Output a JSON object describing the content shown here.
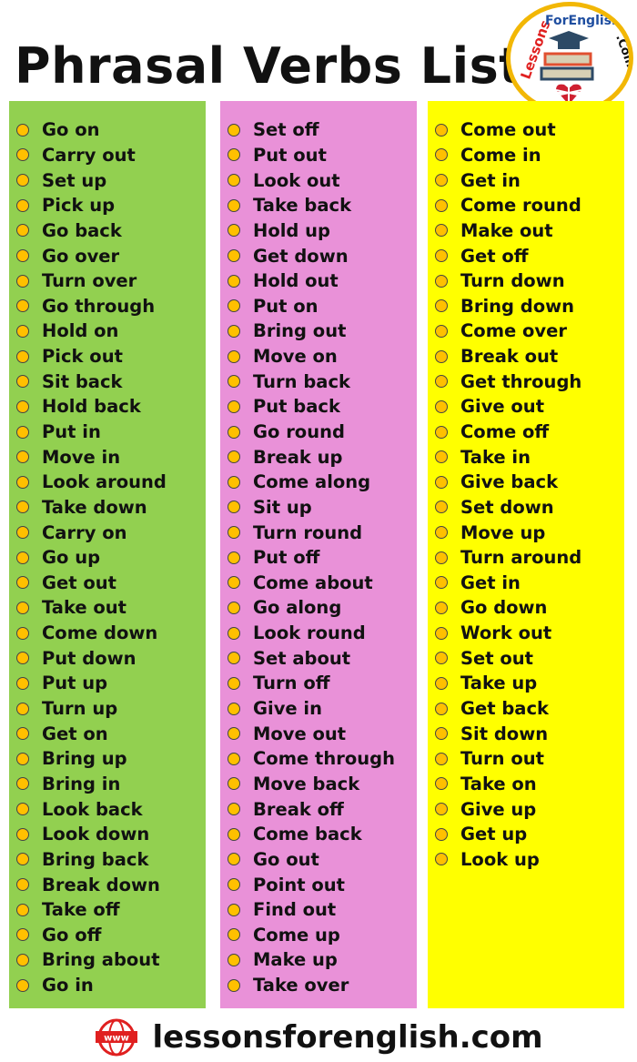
{
  "title": "Phrasal Verbs List",
  "logo_text": "LessonsForEnglish.Com",
  "colors": {
    "column1": "#92d050",
    "column2": "#e991d8",
    "column3": "#ffff00",
    "bullet": "#ffc000"
  },
  "columns": [
    [
      "Go on",
      "Carry out",
      "Set up",
      "Pick up",
      "Go back",
      "Go over",
      "Turn over",
      "Go through",
      "Hold on",
      "Pick out",
      "Sit back",
      "Hold back",
      "Put in",
      "Move in",
      "Look around",
      "Take down",
      "Carry on",
      "Go up",
      "Get out",
      "Take out",
      "Come down",
      "Put down",
      "Put up",
      "Turn up",
      "Get on",
      "Bring up",
      "Bring in",
      "Look back",
      "Look down",
      "Bring back",
      "Break down",
      "Take off",
      "Go off",
      "Bring about",
      "Go in"
    ],
    [
      "Set off",
      "Put out",
      "Look out",
      "Take back",
      "Hold up",
      "Get down",
      "Hold out",
      "Put on",
      "Bring out",
      "Move on",
      "Turn back",
      "Put back",
      "Go round",
      "Break up",
      "Come along",
      "Sit up",
      "Turn round",
      "Put off",
      "Come about",
      "Go along",
      "Look round",
      "Set about",
      "Turn off",
      "Give in",
      "Move out",
      "Come through",
      "Move back",
      "Break off",
      "Come back",
      "Go out",
      "Point out",
      "Find out",
      "Come up",
      "Make up",
      "Take over"
    ],
    [
      "Come out",
      "Come in",
      "Get in",
      "Come round",
      "Make out",
      "Get off",
      "Turn down",
      "Bring down",
      "Come over",
      "Break out",
      "Get through",
      "Give out",
      "Come off",
      "Take in",
      "Give back",
      "Set down",
      "Move up",
      "Turn around",
      "Get in",
      "Go down",
      "Work out",
      "Set out",
      "Take up",
      "Get back",
      "Sit down",
      "Turn out",
      "Take on",
      "Give up",
      "Get up",
      "Look up"
    ]
  ],
  "footer": {
    "website": "lessonsforenglish.com",
    "icon": "www-globe-icon"
  }
}
